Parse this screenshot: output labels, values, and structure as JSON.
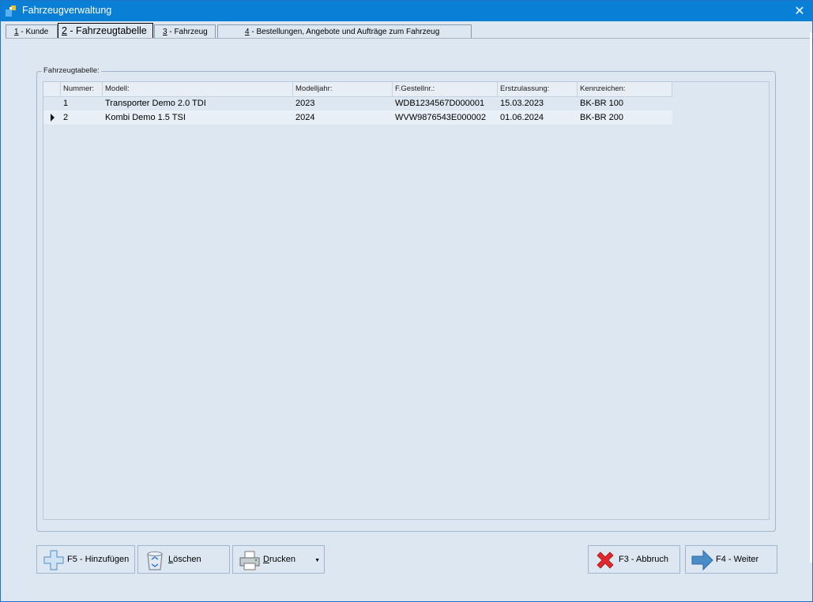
{
  "window": {
    "title": "Fahrzeugverwaltung"
  },
  "tabs": [
    {
      "key": "1",
      "label": " - Kunde"
    },
    {
      "key": "2",
      "label": " - Fahrzeugtabelle"
    },
    {
      "key": "3",
      "label": " - Fahrzeug"
    },
    {
      "key": "4",
      "label": " - Bestellungen, Angebote und Aufträge zum Fahrzeug"
    }
  ],
  "group": {
    "label": "Fahrzeugtabelle:"
  },
  "table": {
    "columns": [
      "Nummer:",
      "Modell:",
      "Modelljahr:",
      "F.Gestellnr.:",
      "Erstzulassung:",
      "Kennzeichen:"
    ],
    "rows": [
      [
        "1",
        "Transporter Demo 2.0 TDI",
        "2023",
        "WDB1234567D000001",
        "15.03.2023",
        "BK-BR 100"
      ],
      [
        "2",
        "Kombi Demo 1.5 TSI",
        "2024",
        "WVW9876543E000002",
        "01.06.2024",
        "BK-BR 200"
      ]
    ],
    "selected_row": 2
  },
  "buttons": {
    "add": {
      "prefix": "F5 - ",
      "label": "Hinzufügen",
      "icon": "plus-icon"
    },
    "delete": {
      "label": "Löschen",
      "icon": "recycle-bin-icon"
    },
    "print": {
      "label": "Drucken",
      "icon": "printer-icon"
    },
    "cancel": {
      "prefix": "F3 - ",
      "label": "Abbruch",
      "icon": "red-x-icon"
    },
    "next": {
      "prefix": "F4 - ",
      "label": "Weiter",
      "icon": "arrow-right-icon"
    }
  },
  "colors": {
    "titlebar": "#0a7fd6",
    "window_bg": "#dde7f1",
    "cancel_red": "#e0282b",
    "next_blue": "#4a8cc8"
  }
}
